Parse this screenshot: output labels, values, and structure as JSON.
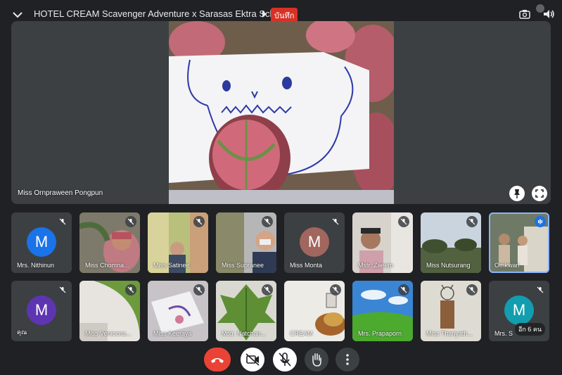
{
  "meeting": {
    "title": "HOTEL CREAM Scavenger Adventure x Sarasas Ektra School",
    "record_badge": "บันทึก"
  },
  "main_video": {
    "speaker": "Miss Ornpraween Pongpun"
  },
  "participants": [
    {
      "name": "Mrs. Nithinun",
      "initial": "M",
      "avatar_color": "#1a73e8"
    },
    {
      "name": "Miss Chomna...",
      "initial": "",
      "avatar_color": ""
    },
    {
      "name": "Miss Satinee",
      "initial": "",
      "avatar_color": ""
    },
    {
      "name": "Miss Supranee",
      "initial": "",
      "avatar_color": ""
    },
    {
      "name": "Miss Monta",
      "initial": "M",
      "avatar_color": "#a1665e"
    },
    {
      "name": "Mstr. Zaeem",
      "initial": "",
      "avatar_color": ""
    },
    {
      "name": "Miss Nutsurang",
      "initial": "",
      "avatar_color": ""
    },
    {
      "name": "Omkwan",
      "initial": "",
      "avatar_color": ""
    },
    {
      "name": "คุณ",
      "initial": "M",
      "avatar_color": "#5e35b1"
    },
    {
      "name": "Miss Venicena...",
      "initial": "",
      "avatar_color": ""
    },
    {
      "name": "Miss Keeraya",
      "initial": "",
      "avatar_color": ""
    },
    {
      "name": "Mstr. Natchan...",
      "initial": "",
      "avatar_color": ""
    },
    {
      "name": "CREAM",
      "initial": "",
      "avatar_color": ""
    },
    {
      "name": "Mrs. Prapaporn",
      "initial": "",
      "avatar_color": ""
    },
    {
      "name": "Miss Thanyath...",
      "initial": "",
      "avatar_color": ""
    },
    {
      "name": "Mrs. S",
      "initial": "M",
      "avatar_color": "#129eaf"
    }
  ],
  "more_participants": "อีก 6 คน",
  "colors": {
    "end_call": "#ea4335",
    "record": "#d93025",
    "active_speaker": "#8ab4f8"
  }
}
